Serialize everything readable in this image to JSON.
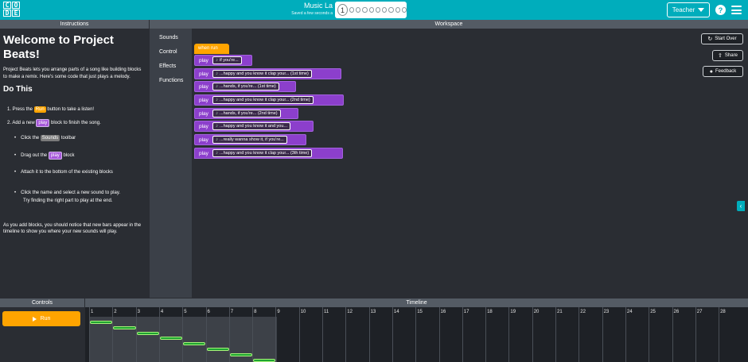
{
  "header": {
    "title": "Music La",
    "subtitle": "Saved a few seconds a",
    "progress_current": "1",
    "progress_total_dots": 9,
    "teacher_label": "Teacher",
    "help_label": "?"
  },
  "instructions": {
    "header": "Instructions",
    "title": "Welcome to Project Beats!",
    "intro": "Project Beats lets you arrange parts of a song like building blocks to make a remix. Here's some code that just plays a melody.",
    "do_this": "Do This",
    "step1_pre": "1. Press the ",
    "step1_pill": "Run",
    "step1_post": " button to take a listen!",
    "step2_pre": "2. Add a new ",
    "step2_pill": "play",
    "step2_post": " block to finish the song.",
    "sub1_pre": "Click the ",
    "sub1_pill": "Sounds",
    "sub1_post": " toolbar",
    "sub2_pre": "Drag out the ",
    "sub2_pill": "play",
    "sub2_post": " block",
    "sub3": "Attach it to the bottom of the existing blocks",
    "sub4_line1": "Click the name and select a new sound to play.",
    "sub4_line2": "Try finding the right part to play at the end.",
    "outro": "As you add blocks, you should notice that new bars appear in the timeline to show you where your new sounds will play."
  },
  "toolbox": {
    "categories": [
      "Sounds",
      "Control",
      "Effects",
      "Functions"
    ]
  },
  "workspace": {
    "header": "Workspace",
    "hat_label": "when run",
    "play_keyword": "play",
    "blocks": [
      {
        "sound": "if you're..."
      },
      {
        "sound": "...happy and you know it clap your... (1st time)"
      },
      {
        "sound": "...hands, if you're... (1st time)"
      },
      {
        "sound": "...happy and you know it clap your... (2nd time)"
      },
      {
        "sound": "...hands, if you're... (2nd time)"
      },
      {
        "sound": "...happy and you know it and you..."
      },
      {
        "sound": "...really wanna show it, if you're..."
      },
      {
        "sound": "...happy and you know it clap your... (3th time)"
      }
    ],
    "start_over_label": "Start Over",
    "share_label": "Share",
    "feedback_label": "Feedback"
  },
  "controls": {
    "header": "Controls",
    "run_label": "Run"
  },
  "timeline": {
    "header": "Timeline",
    "measures": [
      "1",
      "2",
      "3",
      "4",
      "5",
      "6",
      "7",
      "8",
      "9",
      "10",
      "11",
      "12",
      "13",
      "14",
      "15",
      "16",
      "17",
      "18",
      "19",
      "20",
      "21",
      "22",
      "23",
      "24",
      "25",
      "26",
      "27",
      "28"
    ]
  },
  "colors": {
    "accent": "#00adbc",
    "run": "#ffa400",
    "play_block": "#8c3fcc",
    "timeline_bar": "#1ea530"
  }
}
